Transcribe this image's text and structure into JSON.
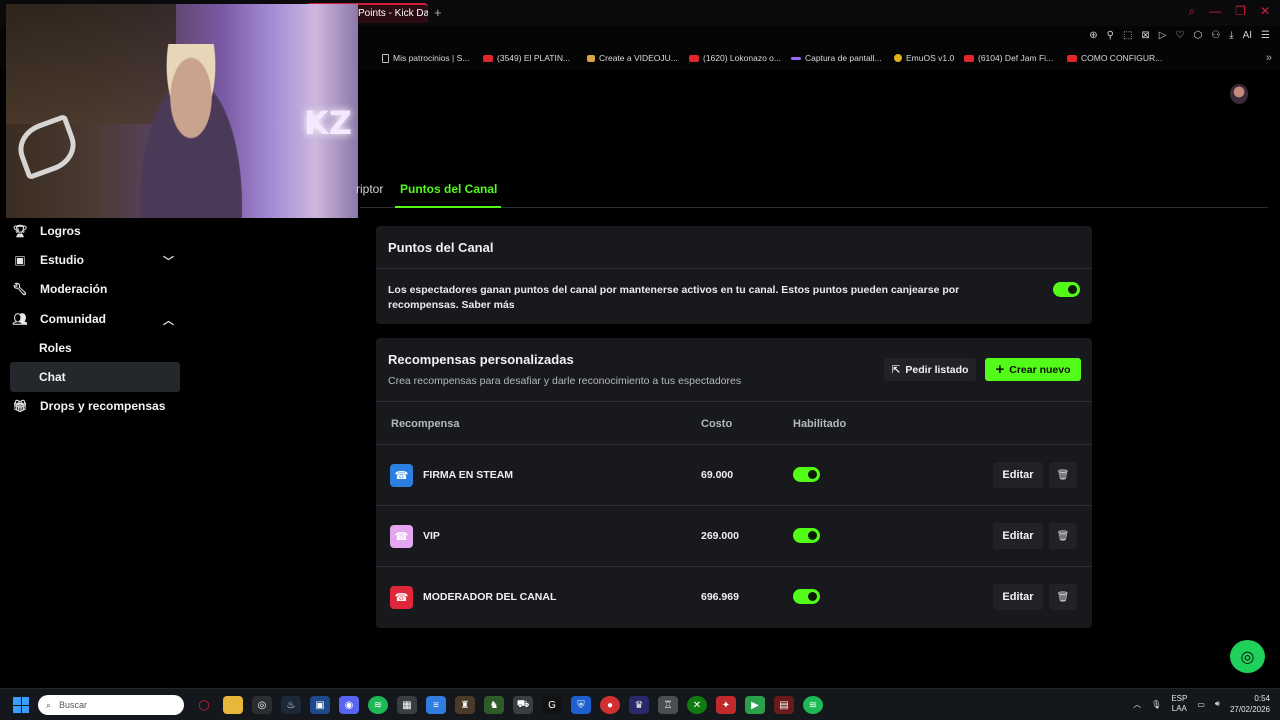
{
  "browser": {
    "tab_title": "Points - Kick Das",
    "bookmarks": [
      {
        "label": "Mis patrocinios | S...",
        "icon": "doc-icon"
      },
      {
        "label": "(3549) El PLATIN...",
        "icon": "youtube-icon"
      },
      {
        "label": "Create a VIDEOJU...",
        "icon": "bookmark-icon"
      },
      {
        "label": "(1620) Lokonazo o...",
        "icon": "youtube-icon"
      },
      {
        "label": "Captura de pantall...",
        "icon": "pen-icon"
      },
      {
        "label": "EmuOS v1.0",
        "icon": "star-icon"
      },
      {
        "label": "(6104) Def Jam Fi...",
        "icon": "youtube-icon"
      },
      {
        "label": "COMO CONFIGUR...",
        "icon": "youtube-icon"
      }
    ]
  },
  "webcam": {
    "neon_text": "KZ"
  },
  "subtabs": [
    {
      "label": "riptor",
      "active": false
    },
    {
      "label": "Puntos del Canal",
      "active": true
    }
  ],
  "sidebar": [
    {
      "label": "Logros",
      "icon": "trophy-icon"
    },
    {
      "label": "Estudio",
      "icon": "studio-icon",
      "chevron": "down"
    },
    {
      "label": "Moderación",
      "icon": "wrench-icon"
    },
    {
      "label": "Comunidad",
      "icon": "community-icon",
      "chevron": "up"
    },
    {
      "label": "Roles",
      "sub": true
    },
    {
      "label": "Chat",
      "sub": true,
      "active": true
    },
    {
      "label": "Drops y recompensas",
      "icon": "gift-icon"
    }
  ],
  "points_card": {
    "title": "Puntos del Canal",
    "description": "Los espectadores ganan puntos del canal por mantenerse activos en tu canal. Estos puntos pueden canjearse por recompensas. Saber más",
    "enabled": true
  },
  "rewards_card": {
    "title": "Recompensas personalizadas",
    "subtitle": "Crea recompensas para desafiar y darle reconocimiento a tus espectadores",
    "request_list_label": "Pedir listado",
    "create_label": "Crear nuevo",
    "columns": [
      "Recompensa",
      "Costo",
      "Habilitado"
    ],
    "rows": [
      {
        "name": "FIRMA EN STEAM",
        "cost": "69.000",
        "enabled": true,
        "color": "#2a7fe0",
        "edit": "Editar"
      },
      {
        "name": "VIP",
        "cost": "269.000",
        "enabled": true,
        "color": "#e4a6f0",
        "edit": "Editar"
      },
      {
        "name": "MODERADOR DEL CANAL",
        "cost": "696.969",
        "enabled": true,
        "color": "#e0263a",
        "edit": "Editar"
      }
    ]
  },
  "accent_color": "#53fc18",
  "taskbar": {
    "search_placeholder": "Buscar",
    "lang_top": "ESP",
    "lang_bottom": "LAA",
    "time": "0:54",
    "date": "27/02/2026"
  }
}
